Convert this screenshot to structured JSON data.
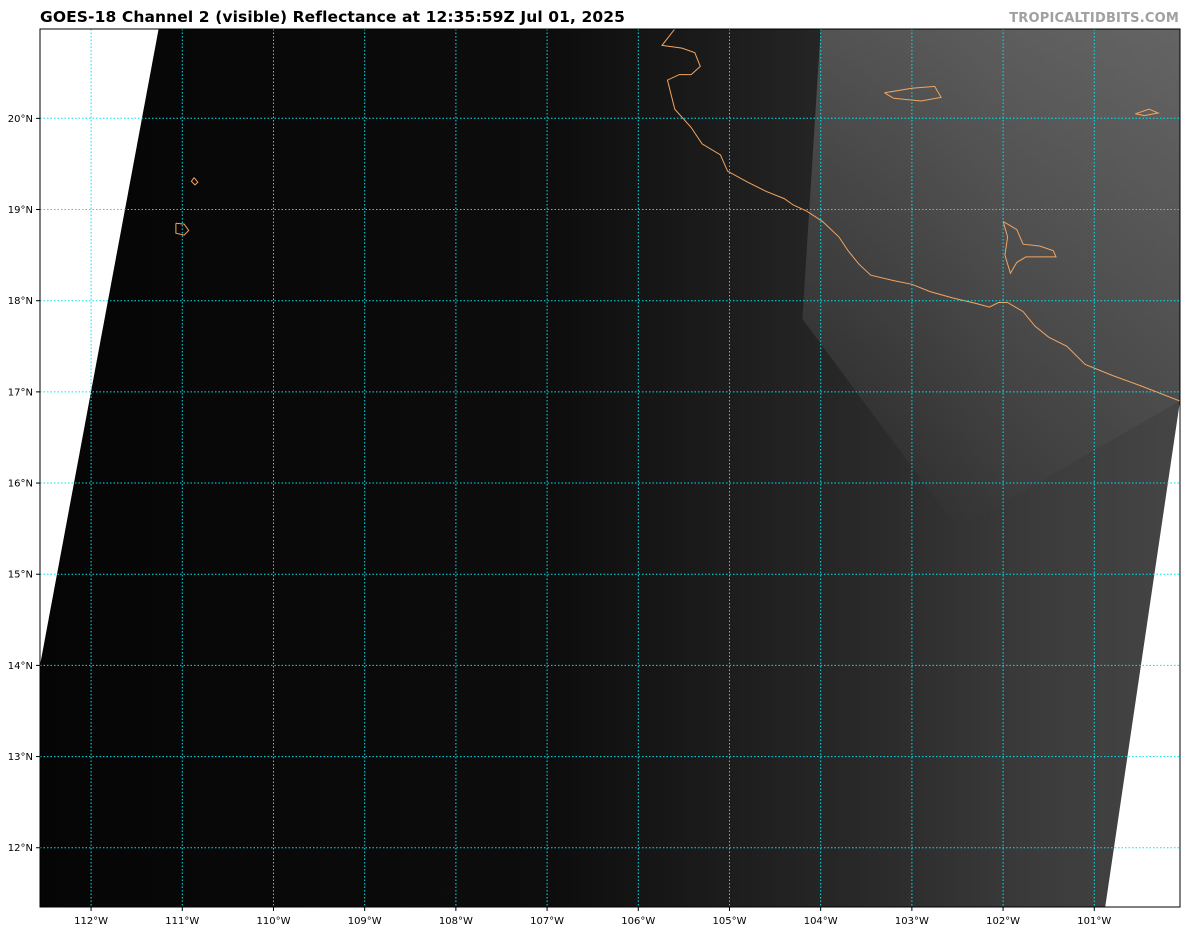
{
  "title": "GOES-18 Channel 2 (visible) Reflectance at 12:35:59Z Jul 01, 2025",
  "credit": "TROPICALTIDBITS.COM",
  "colors": {
    "gridline": "#00e5ee",
    "coastline": "#f4a460",
    "no_data": "#ffffff",
    "background": "#ffffff"
  },
  "map": {
    "projection": "lat-lon",
    "lon_range": [
      -112.56,
      -100.06
    ],
    "lat_range": [
      11.35,
      20.98
    ],
    "lon_ticks": [
      {
        "value": -112,
        "label": "112°W"
      },
      {
        "value": -111,
        "label": "111°W"
      },
      {
        "value": -110,
        "label": "110°W"
      },
      {
        "value": -109,
        "label": "109°W"
      },
      {
        "value": -108,
        "label": "108°W"
      },
      {
        "value": -107,
        "label": "107°W"
      },
      {
        "value": -106,
        "label": "106°W"
      },
      {
        "value": -105,
        "label": "105°W"
      },
      {
        "value": -104,
        "label": "104°W"
      },
      {
        "value": -103,
        "label": "103°W"
      },
      {
        "value": -102,
        "label": "102°W"
      },
      {
        "value": -101,
        "label": "101°W"
      }
    ],
    "lat_ticks": [
      {
        "value": 12,
        "label": "12°N"
      },
      {
        "value": 13,
        "label": "13°N"
      },
      {
        "value": 14,
        "label": "14°N"
      },
      {
        "value": 15,
        "label": "15°N"
      },
      {
        "value": 16,
        "label": "16°N"
      },
      {
        "value": 17,
        "label": "17°N"
      },
      {
        "value": 18,
        "label": "18°N"
      },
      {
        "value": 19,
        "label": "19°N"
      },
      {
        "value": 20,
        "label": "20°N"
      }
    ],
    "swath": {
      "left_edge": [
        [
          -111.26,
          20.98
        ],
        [
          -112.56,
          14.0
        ]
      ],
      "right_edge": [
        [
          -100.06,
          16.9
        ],
        [
          -100.88,
          11.35
        ]
      ]
    },
    "coastline": [
      [
        -105.6,
        20.98
      ],
      [
        -105.74,
        20.8
      ],
      [
        -105.52,
        20.77
      ],
      [
        -105.38,
        20.72
      ],
      [
        -105.32,
        20.57
      ],
      [
        -105.42,
        20.48
      ],
      [
        -105.55,
        20.48
      ],
      [
        -105.68,
        20.42
      ],
      [
        -105.65,
        20.3
      ],
      [
        -105.6,
        20.1
      ],
      [
        -105.42,
        19.9
      ],
      [
        -105.3,
        19.72
      ],
      [
        -105.1,
        19.6
      ],
      [
        -105.02,
        19.42
      ],
      [
        -104.8,
        19.3
      ],
      [
        -104.6,
        19.2
      ],
      [
        -104.4,
        19.12
      ],
      [
        -104.3,
        19.05
      ],
      [
        -104.15,
        18.98
      ],
      [
        -103.98,
        18.87
      ],
      [
        -103.8,
        18.7
      ],
      [
        -103.7,
        18.55
      ],
      [
        -103.58,
        18.4
      ],
      [
        -103.45,
        18.28
      ],
      [
        -103.2,
        18.22
      ],
      [
        -103.0,
        18.18
      ],
      [
        -102.8,
        18.1
      ],
      [
        -102.55,
        18.03
      ],
      [
        -102.3,
        17.97
      ],
      [
        -102.15,
        17.93
      ],
      [
        -102.05,
        17.98
      ],
      [
        -101.95,
        17.98
      ],
      [
        -101.78,
        17.88
      ],
      [
        -101.65,
        17.72
      ],
      [
        -101.5,
        17.6
      ],
      [
        -101.3,
        17.5
      ],
      [
        -101.1,
        17.3
      ],
      [
        -100.8,
        17.18
      ],
      [
        -100.5,
        17.07
      ],
      [
        -100.06,
        16.9
      ]
    ],
    "islands": [
      [
        [
          -110.87,
          19.35
        ],
        [
          -110.83,
          19.3
        ],
        [
          -110.86,
          19.27
        ],
        [
          -110.9,
          19.31
        ],
        [
          -110.87,
          19.35
        ]
      ],
      [
        [
          -111.07,
          18.85
        ],
        [
          -110.98,
          18.84
        ],
        [
          -110.93,
          18.77
        ],
        [
          -110.98,
          18.72
        ],
        [
          -111.07,
          18.74
        ],
        [
          -111.07,
          18.85
        ]
      ],
      [
        [
          -103.3,
          20.28
        ],
        [
          -103.0,
          20.33
        ],
        [
          -102.75,
          20.35
        ],
        [
          -102.68,
          20.23
        ],
        [
          -102.9,
          20.19
        ],
        [
          -103.2,
          20.22
        ],
        [
          -103.3,
          20.28
        ]
      ],
      [
        [
          -100.55,
          20.05
        ],
        [
          -100.4,
          20.1
        ],
        [
          -100.3,
          20.06
        ],
        [
          -100.45,
          20.03
        ],
        [
          -100.55,
          20.05
        ]
      ],
      [
        [
          -102.0,
          18.87
        ],
        [
          -101.85,
          18.78
        ],
        [
          -101.78,
          18.62
        ],
        [
          -101.6,
          18.6
        ],
        [
          -101.45,
          18.55
        ],
        [
          -101.42,
          18.48
        ],
        [
          -101.75,
          18.48
        ],
        [
          -101.85,
          18.42
        ],
        [
          -101.92,
          18.3
        ],
        [
          -101.98,
          18.5
        ],
        [
          -101.95,
          18.7
        ],
        [
          -102.0,
          18.87
        ]
      ]
    ]
  }
}
